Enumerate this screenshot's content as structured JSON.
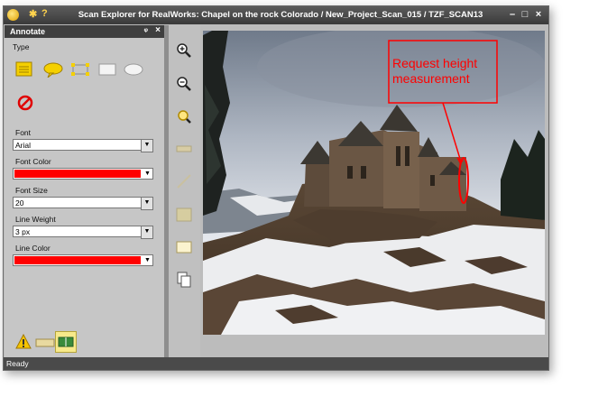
{
  "window": {
    "title": "Scan Explorer for RealWorks: Chapel on the rock Colorado / New_Project_Scan_015 / TZF_SCAN13",
    "minimize": "–",
    "maximize": "□",
    "close": "×"
  },
  "panel": {
    "title": "Annotate",
    "pin": "ᵠ",
    "close": "×",
    "type_label": "Type",
    "font_label": "Font",
    "font_value": "Arial",
    "font_color_label": "Font Color",
    "font_color": "#ff0000",
    "font_size_label": "Font Size",
    "font_size_value": "20",
    "line_weight_label": "Line Weight",
    "line_weight_value": "3 px",
    "line_color_label": "Line Color",
    "line_color": "#ff0000"
  },
  "annotation": {
    "text_line1": "Request height",
    "text_line2": "measurement",
    "color": "#ff0000"
  },
  "status": {
    "text": "Ready"
  },
  "icons": {
    "toolbar": [
      "zoom-in-icon",
      "zoom-out-icon",
      "zoom-extents-icon",
      "measure-icon",
      "line-icon",
      "annotate-icon",
      "image-icon",
      "copy-icon"
    ],
    "bottom": [
      "warning-icon",
      "key-icon",
      "book-icon"
    ]
  }
}
